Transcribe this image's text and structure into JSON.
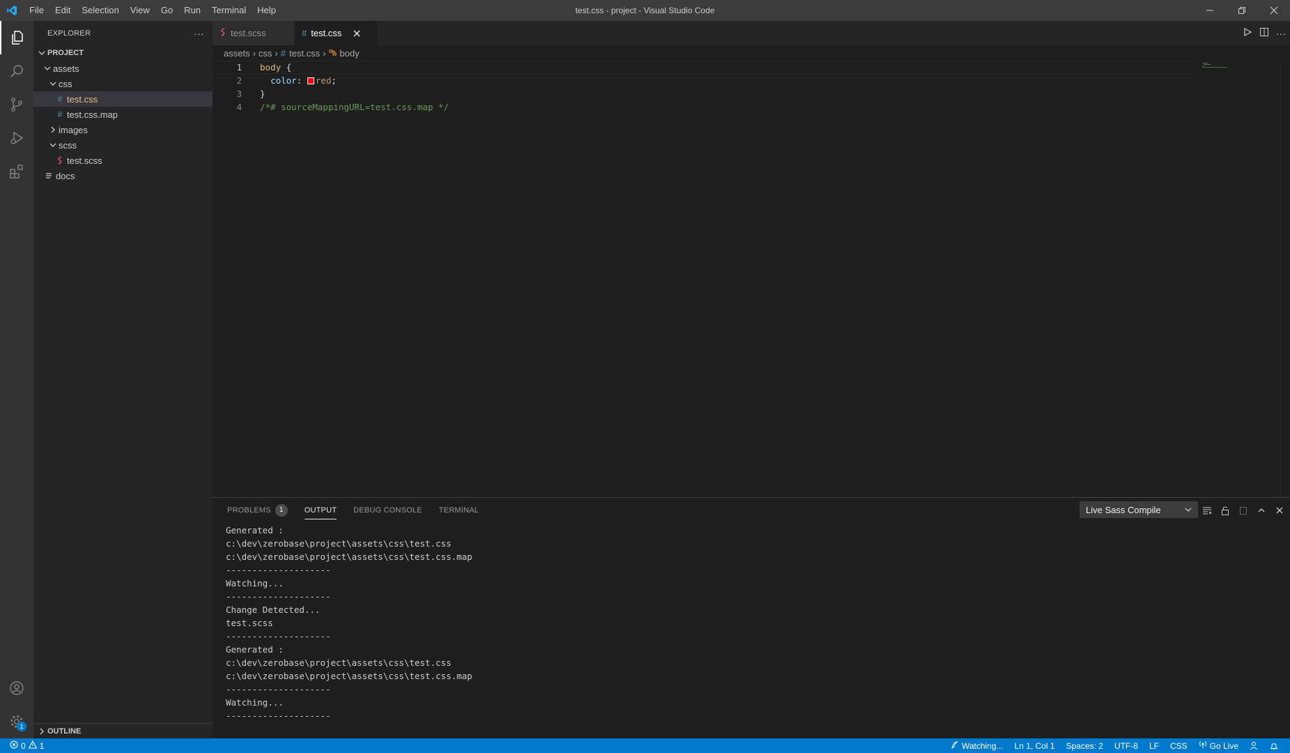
{
  "window": {
    "title": "test.css - project - Visual Studio Code"
  },
  "menu": [
    "File",
    "Edit",
    "Selection",
    "View",
    "Go",
    "Run",
    "Terminal",
    "Help"
  ],
  "sidebar": {
    "title": "EXPLORER",
    "project": "PROJECT",
    "tree": {
      "assets": "assets",
      "css": "css",
      "test_css": "test.css",
      "test_css_map": "test.css.map",
      "images": "images",
      "scss": "scss",
      "test_scss": "test.scss",
      "docs": "docs"
    },
    "outline": "OUTLINE"
  },
  "tabs": [
    {
      "label": "test.scss"
    },
    {
      "label": "test.css"
    }
  ],
  "breadcrumb": {
    "p1": "assets",
    "p2": "css",
    "p3": "test.css",
    "p4": "body"
  },
  "editor": {
    "line_numbers": [
      "1",
      "2",
      "3",
      "4"
    ],
    "l1_selector": "body",
    "l1_brace": " {",
    "l2_prop": "color",
    "l2_colon": ": ",
    "l2_value": "red",
    "l2_semi": ";",
    "l3_brace": "}",
    "l4_comment": "/*# sourceMappingURL=test.css.map */"
  },
  "panel": {
    "tabs": {
      "problems": "PROBLEMS",
      "problems_count": "1",
      "output": "OUTPUT",
      "debug": "DEBUG CONSOLE",
      "terminal": "TERMINAL"
    },
    "select_value": "Live Sass Compile",
    "output_lines": [
      "Generated :",
      "c:\\dev\\zerobase\\project\\assets\\css\\test.css",
      "c:\\dev\\zerobase\\project\\assets\\css\\test.css.map",
      "--------------------",
      "Watching...",
      "--------------------",
      "Change Detected...",
      "test.scss",
      "--------------------",
      "Generated :",
      "c:\\dev\\zerobase\\project\\assets\\css\\test.css",
      "c:\\dev\\zerobase\\project\\assets\\css\\test.css.map",
      "--------------------",
      "Watching...",
      "--------------------"
    ]
  },
  "statusbar": {
    "errors": "0",
    "warnings": "1",
    "watching": "Watching...",
    "position": "Ln 1, Col 1",
    "spaces": "Spaces: 2",
    "encoding": "UTF-8",
    "eol": "LF",
    "language": "CSS",
    "golive": "Go Live"
  },
  "activity_badge": "1",
  "colors": {
    "accent": "#007acc",
    "titlebar": "#3c3c3c",
    "sidebar": "#252526",
    "editor": "#1e1e1e",
    "css_icon": "#519aba",
    "scss_icon": "#f55385",
    "modified": "#e2c08d"
  }
}
